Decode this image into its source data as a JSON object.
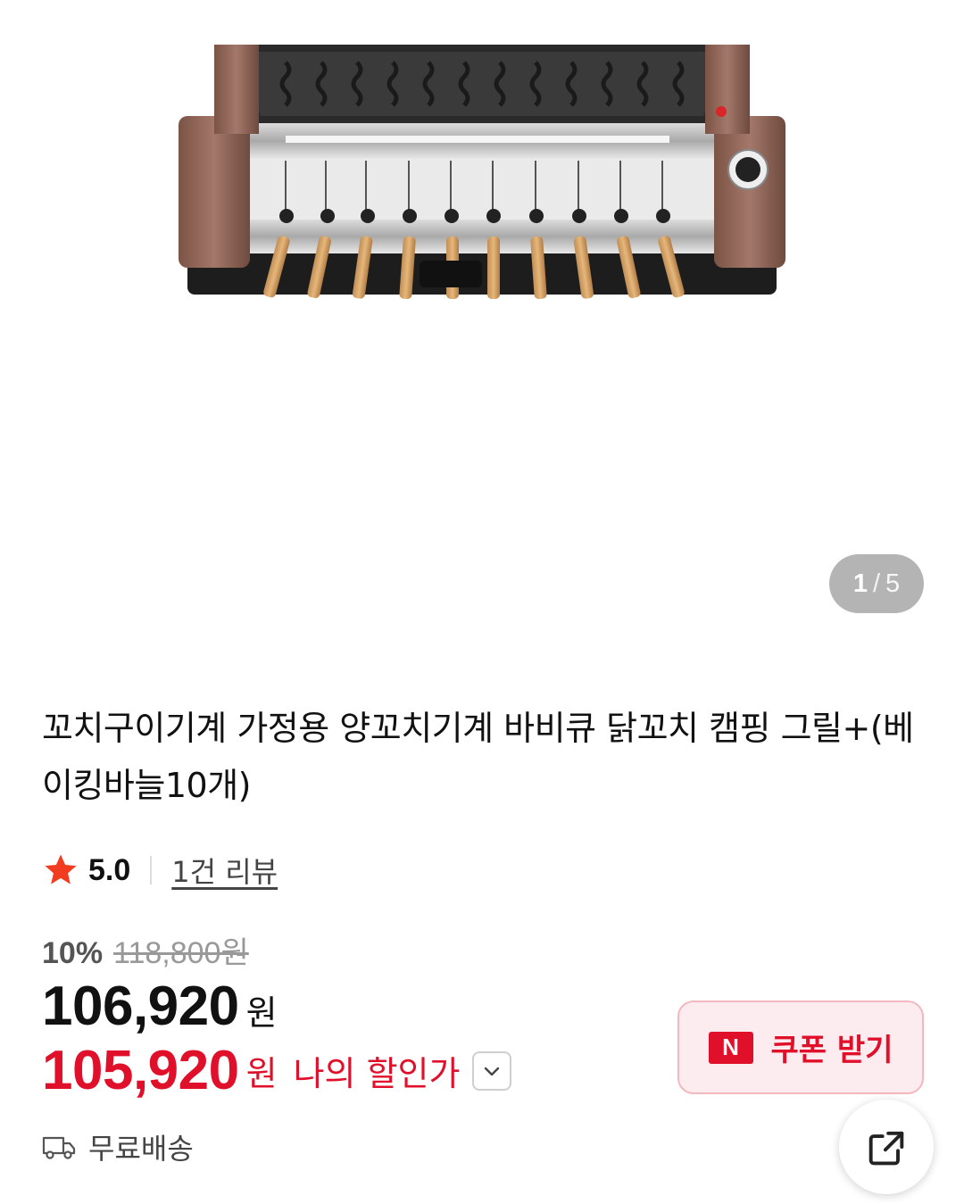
{
  "gallery": {
    "current_page": "1",
    "separator": "/",
    "total_pages": "5",
    "image_icon": "skewer-grill-product-image"
  },
  "product": {
    "title": "꼬치구이기계 가정용 양꼬치기계 바비큐 닭꼬치 캠핑 그릴+(베이킹바늘10개)"
  },
  "rating": {
    "score": "5.0",
    "review_link": "1건 리뷰",
    "star_color": "#f23c1f"
  },
  "price": {
    "discount_rate": "10%",
    "original_price": "118,800원",
    "sale_price": "106,920",
    "sale_unit": "원",
    "my_price": "105,920",
    "my_unit": "원",
    "my_price_label": "나의 할인가",
    "accent_color": "#e0102b"
  },
  "coupon": {
    "badge": "N",
    "label": "쿠폰 받기"
  },
  "shipping": {
    "label": "무료배송",
    "icon": "truck-icon"
  },
  "share": {
    "icon": "share-icon"
  }
}
